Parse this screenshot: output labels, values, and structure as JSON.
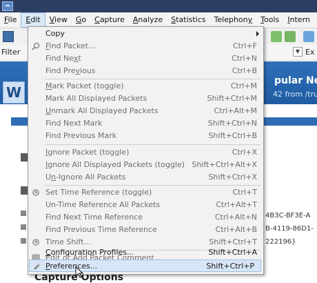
{
  "menubar": [
    {
      "pre": "",
      "u": "F",
      "post": "ile"
    },
    {
      "pre": "",
      "u": "E",
      "post": "dit"
    },
    {
      "pre": "",
      "u": "V",
      "post": "iew"
    },
    {
      "pre": "",
      "u": "G",
      "post": "o"
    },
    {
      "pre": "",
      "u": "C",
      "post": "apture"
    },
    {
      "pre": "",
      "u": "A",
      "post": "nalyze"
    },
    {
      "pre": "",
      "u": "S",
      "post": "tatistics"
    },
    {
      "pre": "Telephon",
      "u": "y",
      "post": ""
    },
    {
      "pre": "",
      "u": "T",
      "post": "ools"
    },
    {
      "pre": "",
      "u": "I",
      "post": "ntern"
    }
  ],
  "filter": {
    "label": "Filter",
    "expression": "Ex"
  },
  "banner": {
    "title": "pular Net",
    "subtitle": "42 from /tru",
    "logo_letter": "W"
  },
  "interfaces": [
    "4B3C-BF3E-A",
    "B-4119-86D1-",
    "222196}"
  ],
  "capture_options": "Capture Options",
  "edit_menu": {
    "items": [
      {
        "pre": "Copy",
        "u": "",
        "post": "",
        "shortcut": "",
        "enabled": true,
        "submenu": true,
        "icon": ""
      },
      {
        "pre": "",
        "u": "F",
        "post": "ind Packet...",
        "shortcut": "Ctrl+F",
        "enabled": false,
        "icon": "search-icon"
      },
      {
        "pre": "Find Ne",
        "u": "x",
        "post": "t",
        "shortcut": "Ctrl+N",
        "enabled": false,
        "icon": ""
      },
      {
        "pre": "Find Pre",
        "u": "v",
        "post": "ious",
        "shortcut": "Ctrl+B",
        "enabled": false,
        "icon": ""
      },
      {
        "pre": "",
        "u": "M",
        "post": "ark Packet (toggle)",
        "shortcut": "Ctrl+M",
        "enabled": false,
        "icon": ""
      },
      {
        "pre": "Mark All Displayed Packets",
        "u": "",
        "post": "",
        "shortcut": "Shift+Ctrl+M",
        "enabled": false,
        "icon": ""
      },
      {
        "pre": "",
        "u": "U",
        "post": "nmark All Displayed Packets",
        "shortcut": "Ctrl+Alt+M",
        "enabled": false,
        "icon": ""
      },
      {
        "pre": "Find Next Mark",
        "u": "",
        "post": "",
        "shortcut": "Shift+Ctrl+N",
        "enabled": false,
        "icon": ""
      },
      {
        "pre": "Find Previous Mark",
        "u": "",
        "post": "",
        "shortcut": "Shift+Ctrl+B",
        "enabled": false,
        "icon": ""
      },
      {
        "pre": "",
        "u": "I",
        "post": "gnore Packet (toggle)",
        "shortcut": "Ctrl+X",
        "enabled": false,
        "icon": ""
      },
      {
        "pre": "",
        "u": "I",
        "post": "gnore All Displayed Packets (toggle)",
        "shortcut": "Shift+Ctrl+Alt+X",
        "enabled": false,
        "icon": ""
      },
      {
        "pre": "U",
        "u": "n",
        "post": "-Ignore All Packets",
        "shortcut": "Shift+Ctrl+X",
        "enabled": false,
        "icon": ""
      },
      {
        "pre": "Set Time Reference (toggle)",
        "u": "",
        "post": "",
        "shortcut": "Ctrl+T",
        "enabled": false,
        "icon": "clock-icon"
      },
      {
        "pre": "Un-Time Reference All Packets",
        "u": "",
        "post": "",
        "shortcut": "Ctrl+Alt+T",
        "enabled": false,
        "icon": ""
      },
      {
        "pre": "Find Next Time Reference",
        "u": "",
        "post": "",
        "shortcut": "Ctrl+Alt+N",
        "enabled": false,
        "icon": ""
      },
      {
        "pre": "Find Previous Time Reference",
        "u": "",
        "post": "",
        "shortcut": "Ctrl+Alt+B",
        "enabled": false,
        "icon": ""
      },
      {
        "pre": "Time Shift...",
        "u": "",
        "post": "",
        "shortcut": "Shift+Ctrl+T",
        "enabled": false,
        "icon": "clock-icon"
      },
      {
        "pre": "Edit or Add Packet Comment...",
        "u": "",
        "post": "",
        "shortcut": "",
        "enabled": false,
        "icon": "comment-icon"
      },
      {
        "pre": "",
        "u": "C",
        "post": "onfiguration Profiles...",
        "shortcut": "Shift+Ctrl+A",
        "enabled": true,
        "icon": ""
      },
      {
        "pre": "",
        "u": "P",
        "post": "references...",
        "shortcut": "Shift+Ctrl+P",
        "enabled": true,
        "highlight": true,
        "icon": "preferences-icon"
      }
    ]
  }
}
